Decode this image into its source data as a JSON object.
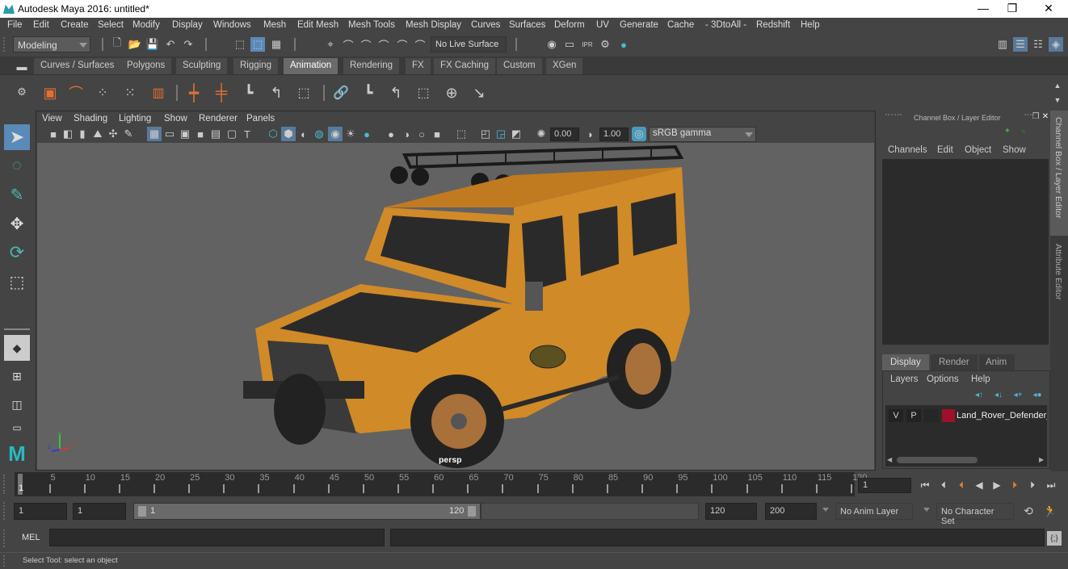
{
  "window": {
    "title": "Autodesk Maya 2016: untitled*",
    "minimize": "—",
    "restore": "❐",
    "close": "✕"
  },
  "menubar": [
    "File",
    "Edit",
    "Create",
    "Select",
    "Modify",
    "Display",
    "Windows",
    "Mesh",
    "Edit Mesh",
    "Mesh Tools",
    "Mesh Display",
    "Curves",
    "Surfaces",
    "Deform",
    "UV",
    "Generate",
    "Cache",
    "- 3DtoAll -",
    "Redshift",
    "Help"
  ],
  "statusline": {
    "mode": "Modeling",
    "live_surface": "No Live Surface"
  },
  "shelf": {
    "tabs": [
      "Curves / Surfaces",
      "Polygons",
      "Sculpting",
      "Rigging",
      "Animation",
      "Rendering",
      "FX",
      "FX Caching",
      "Custom",
      "XGen"
    ],
    "active_tab": "Animation"
  },
  "viewport": {
    "menu": [
      "View",
      "Shading",
      "Lighting",
      "Show",
      "Renderer",
      "Panels"
    ],
    "exposure": "0.00",
    "gamma": "1.00",
    "color_space": "sRGB gamma",
    "camera_label": "persp",
    "axis": {
      "x": "x",
      "y": "y",
      "z": "z"
    }
  },
  "channel_box": {
    "title": "Channel Box / Layer Editor",
    "menu": [
      "Channels",
      "Edit",
      "Object",
      "Show"
    ]
  },
  "layer_editor": {
    "tabs": [
      "Display",
      "Render",
      "Anim"
    ],
    "active_tab": "Display",
    "menu": [
      "Layers",
      "Options",
      "Help"
    ],
    "layers": [
      {
        "v": "V",
        "p": "P",
        "color": "#a0102a",
        "name": "Land_Rover_Defender_"
      }
    ]
  },
  "side_tabs": [
    "Channel Box / Layer Editor",
    "Attribute Editor"
  ],
  "timeline": {
    "ticks": [
      5,
      10,
      15,
      20,
      25,
      30,
      35,
      40,
      45,
      50,
      55,
      60,
      65,
      70,
      75,
      80,
      85,
      90,
      95,
      100,
      105,
      110,
      115,
      120
    ],
    "current_frame": "1",
    "start": 1,
    "end": 120,
    "current_frame_field": "1"
  },
  "range": {
    "start_field": "1",
    "playback_start": "1",
    "slider_start": "1",
    "slider_end": "120",
    "playback_end": "120",
    "end_field": "200",
    "anim_layer": "No Anim Layer",
    "character_set": "No Character Set"
  },
  "command_line": {
    "label": "MEL",
    "value": ""
  },
  "help_line": "Select Tool: select an object"
}
